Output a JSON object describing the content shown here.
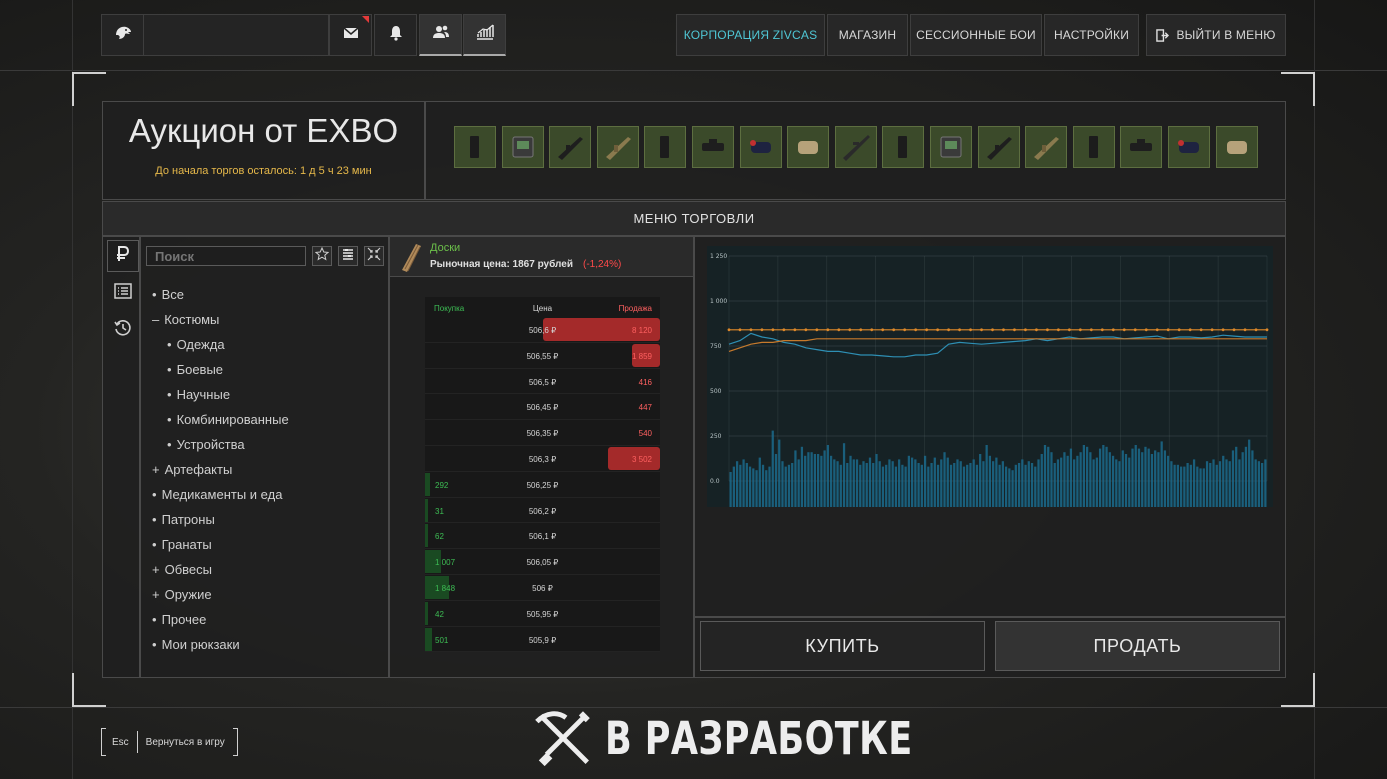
{
  "topbar": {
    "nav": [
      "Корпорация Zivcas",
      "Магазин",
      "Сессионные бои",
      "Настройки",
      "Выйти в меню"
    ],
    "icons": [
      "eagle-logo-icon",
      "mail-icon",
      "bell-icon",
      "friends-icon",
      "stats-icon"
    ]
  },
  "auction": {
    "title": "Аукцион от EXBO",
    "countdown": "До начала торгов осталось: 1 д 5 ч 23 мин",
    "lot_items": [
      "magazine",
      "device",
      "rifle",
      "rifle-camo",
      "magazine",
      "scope",
      "grenade",
      "pouch",
      "sniper-rifle",
      "magazine",
      "device",
      "rifle",
      "rifle-camo",
      "magazine",
      "scope",
      "grenade",
      "pouch"
    ]
  },
  "menu_bar": {
    "label": "МЕНЮ ТОРГОВЛИ"
  },
  "left_tabs": [
    "ruble-icon",
    "list-icon",
    "history-icon"
  ],
  "search": {
    "placeholder": "Поиск"
  },
  "categories": [
    {
      "prefix": "•",
      "label": "Все",
      "sub": false
    },
    {
      "prefix": "–",
      "label": "Костюмы",
      "sub": false
    },
    {
      "prefix": "•",
      "label": "Одежда",
      "sub": true
    },
    {
      "prefix": "•",
      "label": "Боевые",
      "sub": true
    },
    {
      "prefix": "•",
      "label": "Научные",
      "sub": true
    },
    {
      "prefix": "•",
      "label": "Комбинированные",
      "sub": true
    },
    {
      "prefix": "•",
      "label": "Устройства",
      "sub": true
    },
    {
      "prefix": "+",
      "label": "Артефакты",
      "sub": false
    },
    {
      "prefix": "•",
      "label": "Медикаменты и еда",
      "sub": false
    },
    {
      "prefix": "•",
      "label": "Патроны",
      "sub": false
    },
    {
      "prefix": "•",
      "label": "Гранаты",
      "sub": false
    },
    {
      "prefix": "+",
      "label": "Обвесы",
      "sub": false
    },
    {
      "prefix": "+",
      "label": "Оружие",
      "sub": false
    },
    {
      "prefix": "•",
      "label": "Прочее",
      "sub": false
    },
    {
      "prefix": "•",
      "label": "Мои рюкзаки",
      "sub": false
    }
  ],
  "item": {
    "name": "Доски",
    "market_label": "Рыночная цена: 1867 рублей",
    "change": "(-1,24%)",
    "name_color": "#6cc04a",
    "change_color": "#ff4a4a"
  },
  "order_book": {
    "headers": {
      "buy": "Покупка",
      "price": "Цена",
      "sell": "Продажа"
    },
    "rows": [
      {
        "price": "506,6 ₽",
        "sell": "8 120",
        "sell_frac": 0.5
      },
      {
        "price": "506,55 ₽",
        "sell": "1 859",
        "sell_frac": 0.12
      },
      {
        "price": "506,5 ₽",
        "sell": "416",
        "sell_frac": 0.0
      },
      {
        "price": "506,45 ₽",
        "sell": "447",
        "sell_frac": 0.0
      },
      {
        "price": "506,35 ₽",
        "sell": "540",
        "sell_frac": 0.0
      },
      {
        "price": "506,3 ₽",
        "sell": "3 502",
        "sell_frac": 0.22
      },
      {
        "price": "506,25 ₽",
        "buy": "292",
        "buy_frac": 0.02
      },
      {
        "price": "506,2 ₽",
        "buy": "31",
        "buy_frac": 0.01
      },
      {
        "price": "506,1 ₽",
        "buy": "62",
        "buy_frac": 0.01
      },
      {
        "price": "506,05 ₽",
        "buy": "1 007",
        "buy_frac": 0.07
      },
      {
        "price": "506 ₽",
        "buy": "1 848",
        "buy_frac": 0.1
      },
      {
        "price": "505,95 ₽",
        "buy": "42",
        "buy_frac": 0.01
      },
      {
        "price": "505,9 ₽",
        "buy": "501",
        "buy_frac": 0.03
      }
    ]
  },
  "chart_data": {
    "type": "line",
    "y_ticks": [
      "1 250",
      "1 000",
      "750",
      "500",
      "250",
      "0.0"
    ],
    "ylim": [
      0,
      1250
    ],
    "grid": true,
    "series": [
      {
        "values": [
          840,
          840,
          840,
          840,
          840,
          840,
          840,
          840,
          840,
          840,
          840,
          840,
          840,
          840,
          840,
          840,
          840,
          840,
          840,
          840,
          840,
          840,
          840,
          840,
          840,
          840,
          840,
          840,
          840,
          840,
          840,
          840,
          840,
          840,
          840,
          840,
          840,
          840,
          840,
          840,
          840,
          840,
          840,
          840,
          840,
          840,
          840,
          840,
          840,
          840
        ],
        "color": "#e08a2a"
      },
      {
        "values": [
          760,
          780,
          820,
          800,
          790,
          770,
          760,
          740,
          730,
          720,
          720,
          710,
          700,
          700,
          695,
          690,
          690,
          700,
          700,
          710,
          760,
          770,
          765,
          760,
          765,
          770,
          775,
          780,
          790,
          780,
          790,
          800,
          790,
          795,
          800,
          800,
          790,
          795,
          800,
          805,
          790,
          800,
          800,
          795,
          800,
          810,
          805,
          800,
          800,
          800
        ],
        "color": "#2e8fb4"
      },
      {
        "values": [
          720,
          740,
          760,
          770,
          770,
          780,
          780,
          780,
          790,
          790,
          790,
          790,
          790,
          790,
          790,
          790,
          790,
          790,
          790,
          790,
          790,
          790,
          790,
          790,
          790,
          790,
          790,
          790,
          790,
          790,
          790,
          790,
          790,
          790,
          790,
          790,
          790,
          790,
          790,
          790,
          790,
          790,
          790,
          790,
          790,
          790,
          790,
          790,
          790,
          790
        ],
        "color": "#c77a2c"
      }
    ],
    "volume": [
      50,
      80,
      110,
      90,
      120,
      100,
      80,
      70,
      60,
      130,
      90,
      60,
      80,
      280,
      150,
      230,
      110,
      80,
      90,
      100,
      170,
      120,
      190,
      140,
      160,
      160,
      150,
      150,
      140,
      170,
      200,
      140,
      120,
      110,
      90,
      210,
      100,
      140,
      120,
      120,
      90,
      110,
      100,
      130,
      100,
      150,
      110,
      80,
      90,
      120,
      110,
      80,
      120,
      90,
      80,
      140,
      130,
      120,
      100,
      90,
      140,
      80,
      100,
      130,
      90,
      120,
      160,
      130,
      90,
      100,
      120,
      110,
      80,
      90,
      100,
      120,
      90,
      150,
      110,
      200,
      140,
      110,
      130,
      90,
      110,
      80,
      70,
      60,
      90,
      100,
      120,
      90,
      110,
      100,
      80,
      120,
      150,
      200,
      190,
      160,
      100,
      120,
      130,
      160,
      140,
      180,
      120,
      140,
      160,
      200,
      190,
      160,
      120,
      130,
      180,
      200,
      190,
      160,
      140,
      120,
      110,
      170,
      150,
      130,
      180,
      200,
      180,
      160,
      190,
      180,
      150,
      170,
      160,
      220,
      170,
      140,
      110,
      90,
      90,
      80,
      80,
      100,
      90,
      120,
      80,
      70,
      70,
      110,
      100,
      120,
      90,
      110,
      140,
      120,
      110,
      170,
      190,
      120,
      160,
      190,
      230,
      170,
      120,
      110,
      100,
      120
    ],
    "volume_color": "#1b6a8c"
  },
  "actions": {
    "buy": "КУПИТЬ",
    "sell": "ПРОДАТЬ"
  },
  "footer": {
    "esc_key": "Esc",
    "back_label": "Вернуться в игру",
    "dev_label": "В РАЗРАБОТКЕ"
  }
}
